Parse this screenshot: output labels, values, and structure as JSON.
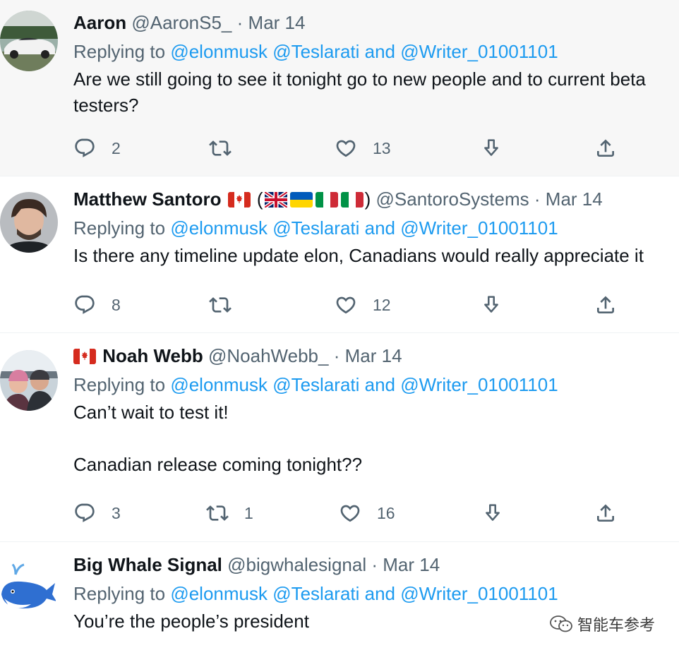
{
  "tweets": [
    {
      "name": "Aaron",
      "handle": "@AaronS5_",
      "date": "Mar 14",
      "reply_prefix": "Replying to",
      "mentions": "@elonmusk @Teslarati and @Writer_01001101",
      "text_lines": [
        "Are we still going to see it tonight go to new people and to current beta",
        "testers?"
      ],
      "replies": "2",
      "retweets": "",
      "likes": "13"
    },
    {
      "name": "Matthew Santoro",
      "open_paren": "(",
      "close_paren": ")",
      "handle": "@SantoroSystems",
      "date": "Mar 14",
      "reply_prefix": "Replying to",
      "mentions": "@elonmusk @Teslarati and @Writer_01001101",
      "text_lines": [
        "Is there any timeline update elon, Canadians would really appreciate it"
      ],
      "replies": "8",
      "retweets": "",
      "likes": "12"
    },
    {
      "name": "Noah Webb",
      "handle": "@NoahWebb_",
      "date": "Mar 14",
      "reply_prefix": "Replying to",
      "mentions": "@elonmusk @Teslarati and @Writer_01001101",
      "text_lines": [
        "Can’t wait to test it!",
        "",
        "Canadian release coming tonight??"
      ],
      "replies": "3",
      "retweets": "1",
      "likes": "16"
    },
    {
      "name": "Big Whale Signal",
      "handle": "@bigwhalesignal",
      "date": "Mar 14",
      "reply_prefix": "Replying to",
      "mentions": "@elonmusk @Teslarati and @Writer_01001101",
      "text_lines": [
        "You’re the people’s president"
      ]
    }
  ],
  "separator": "·",
  "watermark": "智能车参考",
  "icons": [
    "reply-icon",
    "retweet-icon",
    "like-icon",
    "download-icon",
    "share-icon",
    "wechat-icon"
  ],
  "colors": {
    "link": "#1d9bf0",
    "secondary": "#536471",
    "text": "#0f1419",
    "highlight_bg": "#f7f7f7"
  }
}
